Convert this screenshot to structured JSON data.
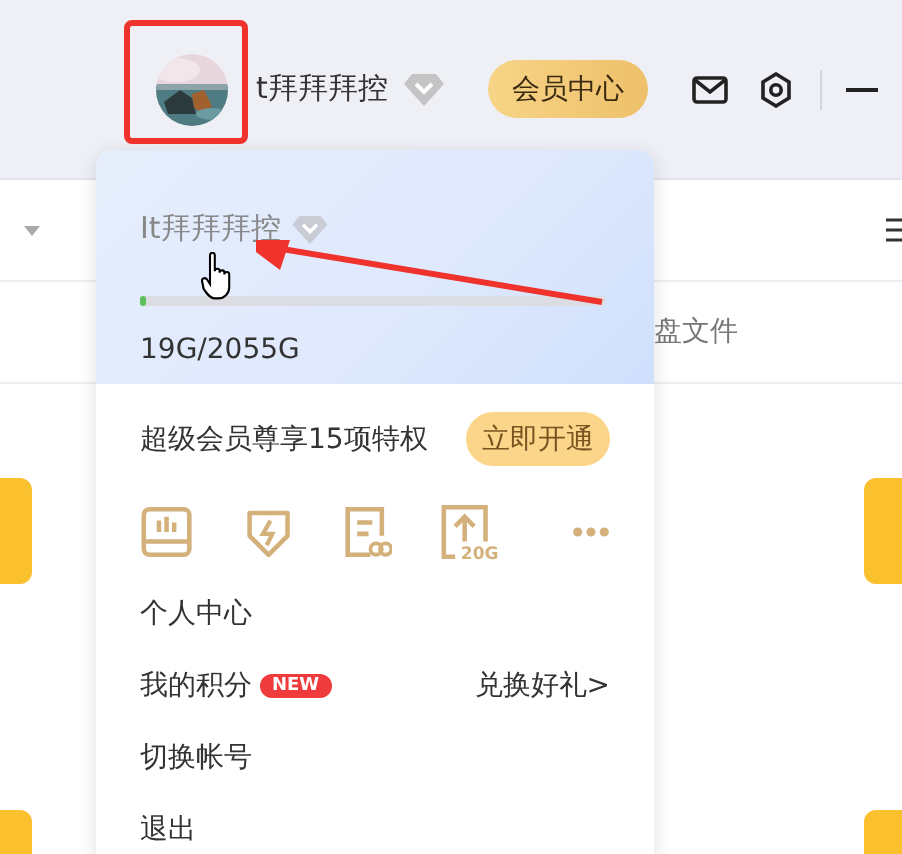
{
  "header": {
    "username": "t拜拜拜控",
    "vip_button": "会员中心"
  },
  "file_header": {
    "label": "盘文件"
  },
  "dropdown": {
    "name": "It拜拜拜控",
    "storage": {
      "level": 0.01,
      "reading": "19G/2055G"
    },
    "promo": {
      "text": "超级会员尊享15项特权",
      "button": "立即开通"
    },
    "quick_icons": [
      {
        "kind": "card"
      },
      {
        "kind": "bolt"
      },
      {
        "kind": "doc"
      },
      {
        "kind": "upload",
        "label": "20G"
      },
      {
        "kind": "more"
      }
    ],
    "menu": [
      {
        "label": "个人中心"
      },
      {
        "label": "我的积分",
        "badge": "NEW",
        "action": "兑换好礼>"
      },
      {
        "label": "切换帐号"
      },
      {
        "label": "退出"
      }
    ]
  }
}
